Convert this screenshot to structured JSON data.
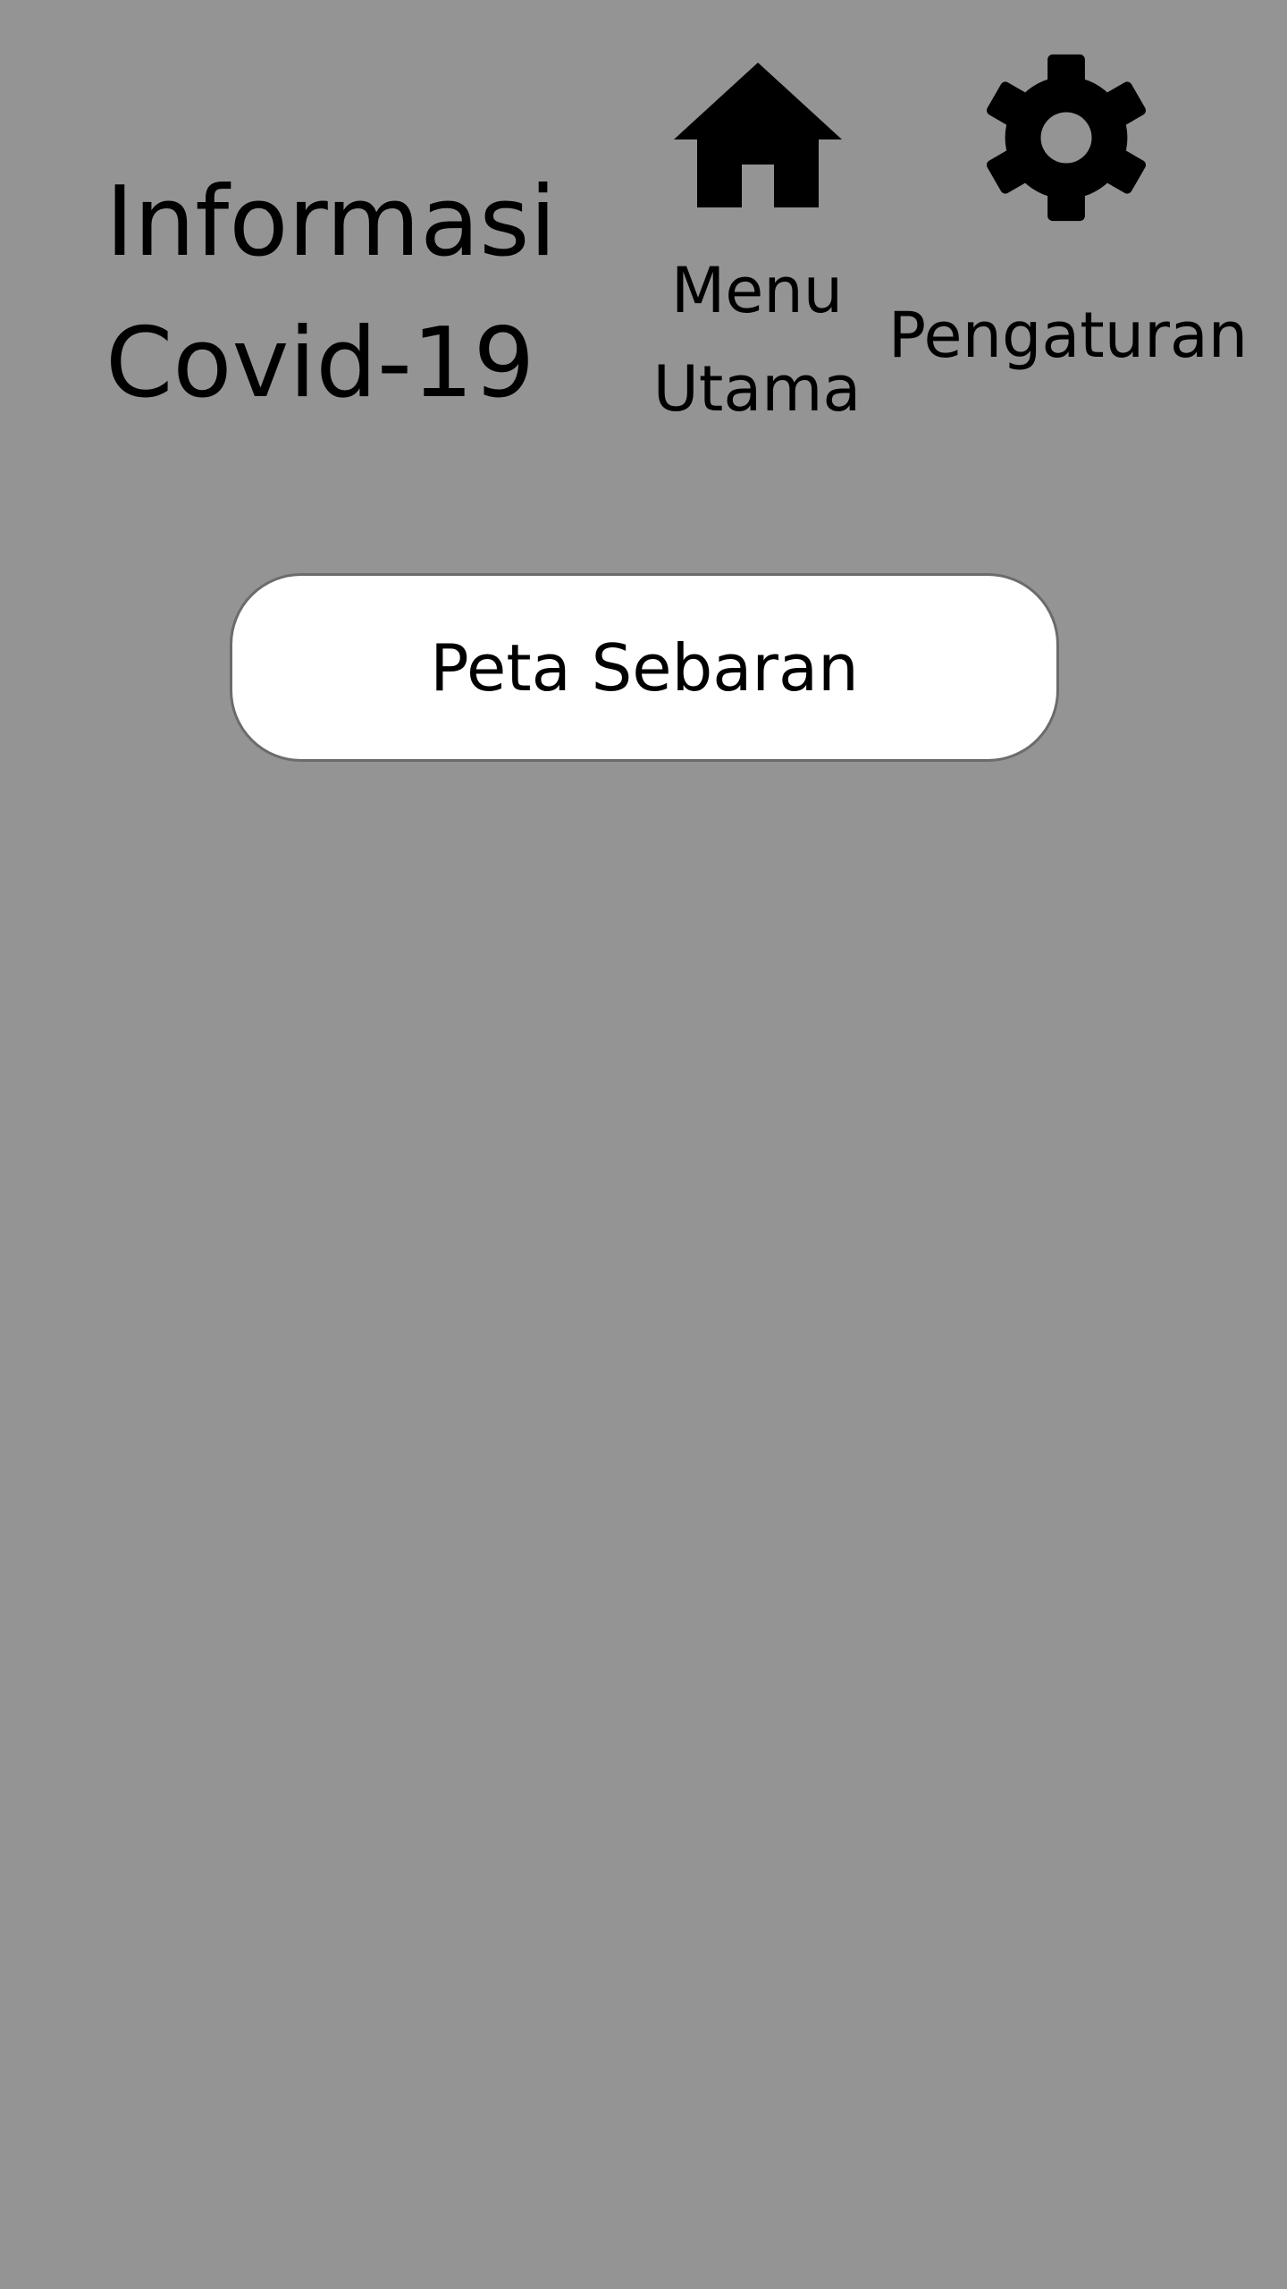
{
  "header": {
    "title_line1": "Informasi",
    "title_line2": "Covid-19"
  },
  "nav": {
    "home": {
      "icon": "home-icon",
      "label_line1": "Menu",
      "label_line2": "Utama"
    },
    "settings": {
      "icon": "gear-icon",
      "label": "Pengaturan"
    }
  },
  "main": {
    "map_button_label": "Peta Sebaran"
  },
  "colors": {
    "background": "#949494",
    "button_background": "#ffffff",
    "button_border": "#6b6b6b",
    "text": "#000000"
  }
}
